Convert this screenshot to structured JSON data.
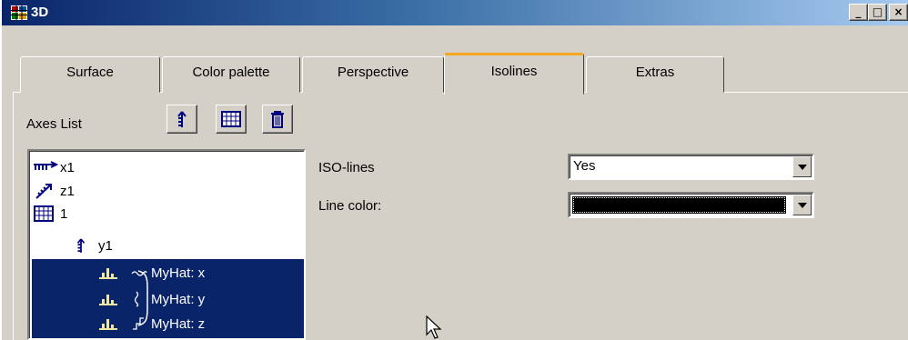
{
  "window": {
    "title": "3D",
    "controls": {
      "minimize": "_",
      "maximize": "□",
      "close": "×"
    }
  },
  "tabs": [
    {
      "label": "Surface",
      "active": false
    },
    {
      "label": "Color palette",
      "active": false
    },
    {
      "label": "Perspective",
      "active": false
    },
    {
      "label": "Isolines",
      "active": true
    },
    {
      "label": "Extras",
      "active": false
    }
  ],
  "axes": {
    "label": "Axes List",
    "buttons": [
      "axis-up-icon",
      "grid-icon",
      "trash-icon"
    ],
    "items": [
      {
        "label": "x1",
        "icon": "x-axis-icon",
        "selected": false
      },
      {
        "label": "z1",
        "icon": "z-axis-icon",
        "selected": false
      },
      {
        "label": "1",
        "icon": "grid-icon",
        "selected": false
      },
      {
        "label": "y1",
        "icon": "y-axis-icon",
        "selected": false
      },
      {
        "label": "MyHat: x",
        "icon": "bar-chart-icon",
        "selected": true
      },
      {
        "label": "MyHat: y",
        "icon": "bar-chart-icon",
        "selected": true
      },
      {
        "label": "MyHat: z",
        "icon": "bar-chart-icon",
        "selected": true
      }
    ]
  },
  "settings": {
    "iso_lines_label": "ISO-lines",
    "iso_lines_value": "Yes",
    "line_color_label": "Line color:",
    "line_color_value": "#000000"
  },
  "colors": {
    "title_start": "#0a246a",
    "title_end": "#a6caf0",
    "selection": "#0a246a",
    "active_tab_accent": "#f5a623",
    "face": "#d4d0c8"
  }
}
